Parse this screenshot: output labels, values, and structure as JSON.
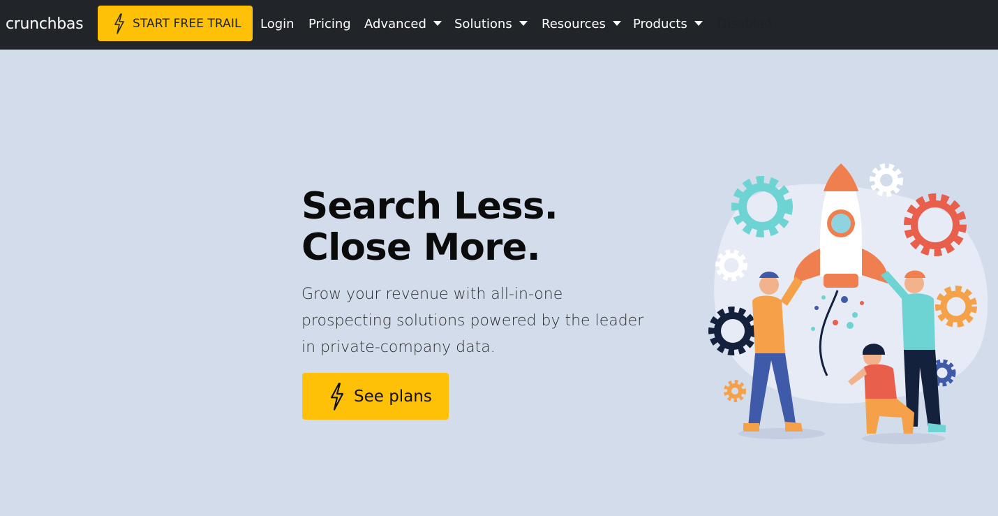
{
  "navbar": {
    "brand": "crunchbas",
    "trial_button": {
      "label": "START FREE TRAIL",
      "icon": "lightning-bolt-icon"
    },
    "links": {
      "login": "Login",
      "pricing": "Pricing",
      "advanced": "Advanced",
      "solutions": "Solutions",
      "resources": "Resources",
      "products": "Products",
      "disabled": "Disabled"
    }
  },
  "hero": {
    "headline_line1": "Search Less.",
    "headline_line2": "Close More.",
    "lead_line1": "Grow your revenue with all-in-one",
    "lead_line2": "prospecting solutions powered by the leader",
    "lead_line3": "in private-company data.",
    "cta": {
      "label": "See plans",
      "icon": "lightning-bolt-icon"
    },
    "illustration": "rocket-launch-team-illustration"
  },
  "colors": {
    "navbar_bg": "#212529",
    "page_bg": "#d2dcea",
    "accent": "#ffc107"
  }
}
